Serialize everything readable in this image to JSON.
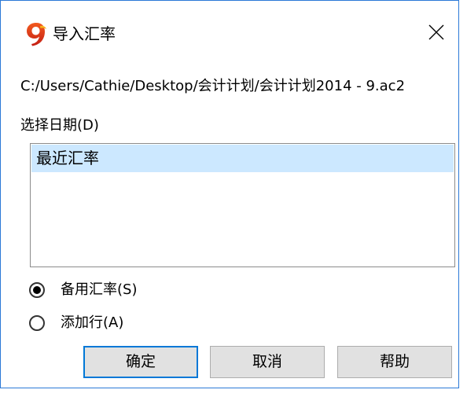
{
  "dialog": {
    "title": "导入汇率",
    "close_icon": "close-icon",
    "app_icon": "app-logo-9-icon",
    "accent_color": "#0078d7",
    "selection_color": "#cce8ff"
  },
  "file_path": "C:/Users/Cathie/Desktop/会计计划/会计计划2014 - 9.ac2",
  "date_section": {
    "label": "选择日期(D)",
    "items": [
      {
        "label": "最近汇率",
        "selected": true
      }
    ]
  },
  "options": [
    {
      "label": "备用汇率(S)",
      "checked": true
    },
    {
      "label": "添加行(A)",
      "checked": false
    }
  ],
  "buttons": {
    "ok_label": "确定",
    "cancel_label": "取消",
    "help_label": "帮助"
  }
}
